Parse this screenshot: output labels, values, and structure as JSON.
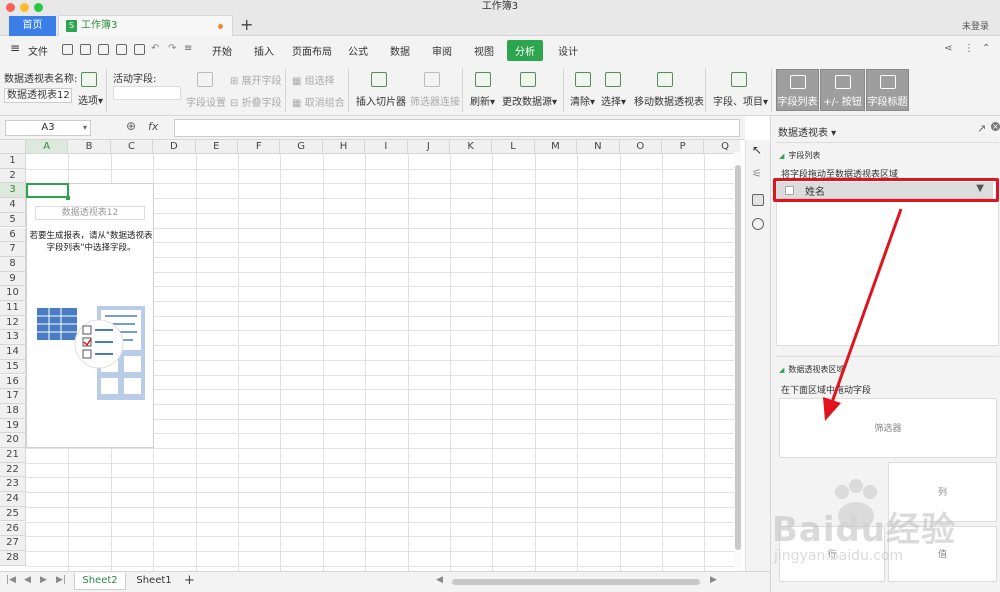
{
  "window": {
    "title": "工作簿3",
    "login": "未登录"
  },
  "tabs": {
    "home": "首页",
    "doc": "工作簿3",
    "doc_icon": "S"
  },
  "menu": {
    "file": "文件",
    "items": [
      "开始",
      "插入",
      "页面布局",
      "公式",
      "数据",
      "审阅",
      "视图",
      "分析",
      "设计"
    ]
  },
  "ribbon": {
    "pivot_name_label": "数据透视表名称:",
    "pivot_name_value": "数据透视表12",
    "options": "选项",
    "active_field_label": "活动字段:",
    "field_settings": "字段设置",
    "expand_field": "展开字段",
    "collapse_field": "折叠字段",
    "group_select": "组选择",
    "ungroup": "取消组合",
    "insert_slicer": "插入切片器",
    "filter_connect": "筛选器连接",
    "refresh": "刷新",
    "change_source": "更改数据源",
    "clear": "清除",
    "select": "选择",
    "move_pivot": "移动数据透视表",
    "fields_items": "字段、项目",
    "field_list": "字段列表",
    "plus_minus": "+/- 按钮",
    "field_headers": "字段标题"
  },
  "formula": {
    "cell_ref": "A3",
    "fx": "fx"
  },
  "grid": {
    "columns": [
      "A",
      "B",
      "C",
      "D",
      "E",
      "F",
      "G",
      "H",
      "I",
      "J",
      "K",
      "L",
      "M",
      "N",
      "O",
      "P",
      "Q"
    ],
    "rows": [
      "1",
      "2",
      "3",
      "4",
      "5",
      "6",
      "7",
      "8",
      "9",
      "10",
      "11",
      "12",
      "13",
      "14",
      "15",
      "16",
      "17",
      "18",
      "19",
      "20",
      "21",
      "22",
      "23",
      "24",
      "25",
      "26",
      "27",
      "28"
    ]
  },
  "pivot_placeholder": {
    "title": "数据透视表12",
    "instruction_line1": "若要生成报表，请从\"数据透视表",
    "instruction_line2": "字段列表\"中选择字段。"
  },
  "sheets": {
    "tabs": [
      "Sheet2",
      "Sheet1"
    ],
    "active": "Sheet2"
  },
  "panel": {
    "title": "数据透视表",
    "field_list_section": "字段列表",
    "drag_hint": "将字段拖动至数据透视表区域",
    "fields": [
      "姓名"
    ],
    "area_section": "数据透视表区域",
    "area_hint": "在下面区域中拖动字段",
    "filter_zone": "筛选器",
    "column_zone": "列",
    "row_zone": "行",
    "value_zone": "值"
  },
  "watermark": {
    "brand": "Baidu经验",
    "url": "jingyan.baidu.com"
  },
  "colors": {
    "accent": "#2da44e",
    "tab_blue": "#3a7ee8",
    "highlight_red": "#e0141e"
  }
}
